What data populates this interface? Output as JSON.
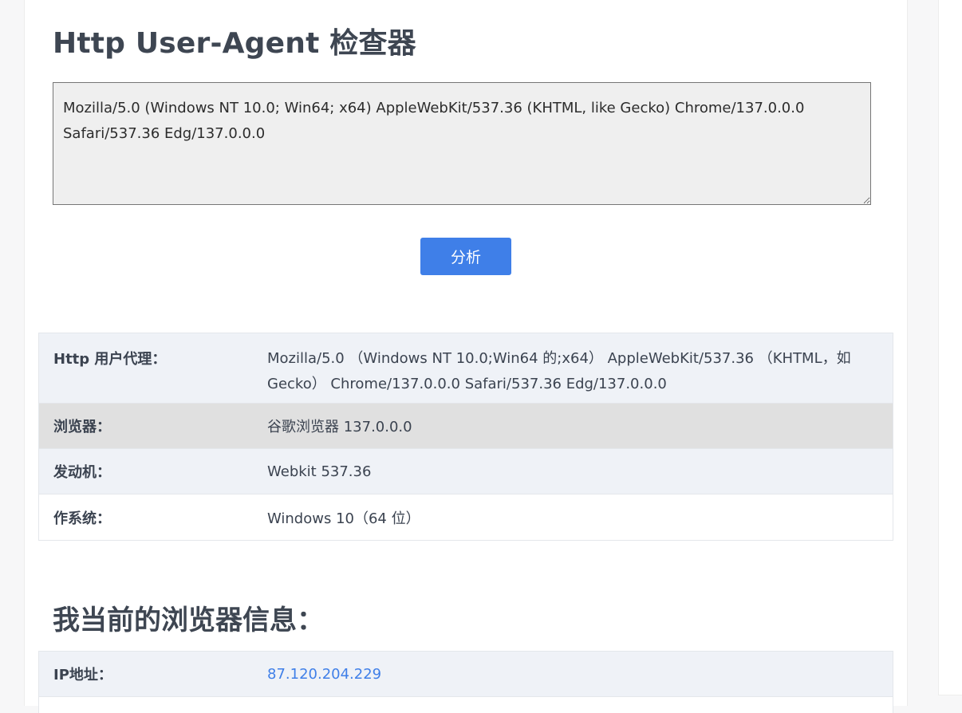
{
  "page": {
    "title": "Http User-Agent 检查器"
  },
  "input": {
    "value": "Mozilla/5.0 (Windows NT 10.0; Win64; x64) AppleWebKit/537.36 (KHTML, like Gecko) Chrome/137.0.0.0 Safari/537.36 Edg/137.0.0.0"
  },
  "analyze_button": {
    "label": "分析"
  },
  "result_table": {
    "rows": [
      {
        "label": "Http 用户代理：",
        "value": "Mozilla/5.0 （Windows NT 10.0;Win64 的;x64） AppleWebKit/537.36 （KHTML，如 Gecko） Chrome/137.0.0.0 Safari/537.36 Edg/137.0.0.0"
      },
      {
        "label": "浏览器：",
        "value": "谷歌浏览器 137.0.0.0"
      },
      {
        "label": "发动机：",
        "value": "Webkit 537.36"
      },
      {
        "label": "作系统：",
        "value": "Windows 10（64 位）"
      }
    ]
  },
  "my_browser": {
    "title": "我当前的浏览器信息：",
    "rows": [
      {
        "label": "IP地址：",
        "value": "87.120.204.229"
      }
    ]
  },
  "colors": {
    "accent": "#3f7fe8",
    "row_blue": "#eff2f7",
    "row_gray": "#e0e0e0"
  }
}
